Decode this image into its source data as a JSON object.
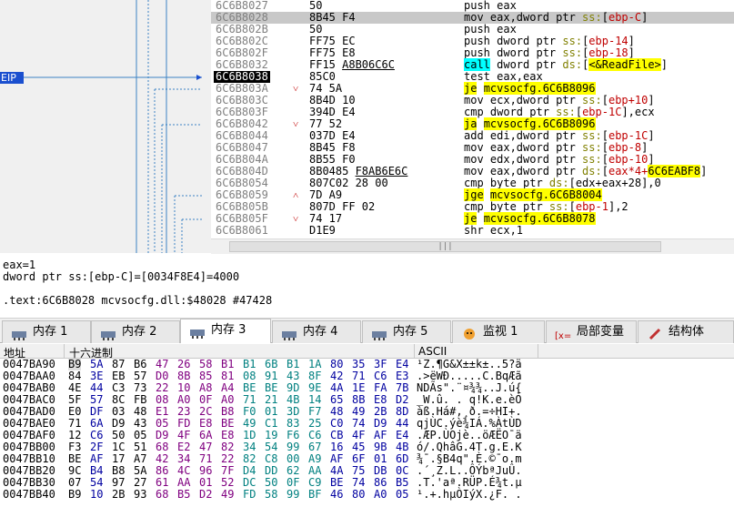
{
  "disasm": {
    "eip_label": "EIP",
    "rows": [
      {
        "addr": "6C6B8027",
        "bytes": "50",
        "jm": "",
        "ins": [
          [
            "push ",
            "t"
          ],
          [
            "eax",
            "t"
          ]
        ]
      },
      {
        "addr": "6C6B8028",
        "bytes": "8B45 F4",
        "jm": "",
        "sel": true,
        "ins": [
          [
            "mov eax,dword ptr ",
            "t"
          ],
          [
            "ss:",
            "s"
          ],
          [
            "[",
            "t"
          ],
          [
            "ebp-C",
            "o"
          ],
          [
            "]",
            "t"
          ]
        ]
      },
      {
        "addr": "6C6B802B",
        "bytes": "50",
        "jm": "",
        "ins": [
          [
            "push eax",
            "t"
          ]
        ]
      },
      {
        "addr": "6C6B802C",
        "bytes": "FF75 EC",
        "jm": "",
        "ins": [
          [
            "push dword ptr ",
            "t"
          ],
          [
            "ss:",
            "s"
          ],
          [
            "[",
            "t"
          ],
          [
            "ebp-14",
            "o"
          ],
          [
            "]",
            "t"
          ]
        ]
      },
      {
        "addr": "6C6B802F",
        "bytes": "FF75 E8",
        "jm": "",
        "ins": [
          [
            "push dword ptr ",
            "t"
          ],
          [
            "ss:",
            "s"
          ],
          [
            "[",
            "t"
          ],
          [
            "ebp-18",
            "o"
          ],
          [
            "]",
            "t"
          ]
        ]
      },
      {
        "addr": "6C6B8032",
        "bytes": "FF15 A8B06C6C",
        "jm": "",
        "ins": [
          [
            "call",
            "c"
          ],
          [
            " dword ptr ",
            "t"
          ],
          [
            "ds:",
            "s"
          ],
          [
            "[",
            "t"
          ],
          [
            "<&ReadFile>",
            "y"
          ],
          [
            "]",
            "t"
          ]
        ]
      },
      {
        "addr": "6C6B8038",
        "bytes": "85C0",
        "jm": "",
        "cur": true,
        "ins": [
          [
            "test eax,eax",
            "t"
          ]
        ]
      },
      {
        "addr": "6C6B803A",
        "bytes": "74 5A",
        "jm": "˅",
        "ins": [
          [
            "je",
            "y"
          ],
          [
            " ",
            "t"
          ],
          [
            "mcvsocfg.6C6B8096",
            "y"
          ]
        ]
      },
      {
        "addr": "6C6B803C",
        "bytes": "8B4D 10",
        "jm": "",
        "ins": [
          [
            "mov ecx,dword ptr ",
            "t"
          ],
          [
            "ss:",
            "s"
          ],
          [
            "[",
            "t"
          ],
          [
            "ebp+10",
            "o"
          ],
          [
            "]",
            "t"
          ]
        ]
      },
      {
        "addr": "6C6B803F",
        "bytes": "394D E4",
        "jm": "",
        "ins": [
          [
            "cmp dword ptr ",
            "t"
          ],
          [
            "ss:",
            "s"
          ],
          [
            "[",
            "t"
          ],
          [
            "ebp-1C",
            "o"
          ],
          [
            "],ecx",
            "t"
          ]
        ]
      },
      {
        "addr": "6C6B8042",
        "bytes": "77 52",
        "jm": "˅",
        "ins": [
          [
            "ja",
            "y"
          ],
          [
            " ",
            "t"
          ],
          [
            "mcvsocfg.6C6B8096",
            "y"
          ]
        ]
      },
      {
        "addr": "6C6B8044",
        "bytes": "037D E4",
        "jm": "",
        "ins": [
          [
            "add edi,dword ptr ",
            "t"
          ],
          [
            "ss:",
            "s"
          ],
          [
            "[",
            "t"
          ],
          [
            "ebp-1C",
            "o"
          ],
          [
            "]",
            "t"
          ]
        ]
      },
      {
        "addr": "6C6B8047",
        "bytes": "8B45 F8",
        "jm": "",
        "ins": [
          [
            "mov eax,dword ptr ",
            "t"
          ],
          [
            "ss:",
            "s"
          ],
          [
            "[",
            "t"
          ],
          [
            "ebp-8",
            "o"
          ],
          [
            "]",
            "t"
          ]
        ]
      },
      {
        "addr": "6C6B804A",
        "bytes": "8B55 F0",
        "jm": "",
        "ins": [
          [
            "mov edx,dword ptr ",
            "t"
          ],
          [
            "ss:",
            "s"
          ],
          [
            "[",
            "t"
          ],
          [
            "ebp-10",
            "o"
          ],
          [
            "]",
            "t"
          ]
        ]
      },
      {
        "addr": "6C6B804D",
        "bytes": "8B0485 F8AB6E6C",
        "jm": "",
        "ins": [
          [
            "mov eax,dword ptr ",
            "t"
          ],
          [
            "ds:",
            "s"
          ],
          [
            "[",
            "t"
          ],
          [
            "eax*4+",
            "o"
          ],
          [
            "6C6EABF8",
            "y"
          ],
          [
            "]",
            "t"
          ]
        ]
      },
      {
        "addr": "6C6B8054",
        "bytes": "807C02 28 00",
        "jm": "",
        "ins": [
          [
            "cmp byte ptr ",
            "t"
          ],
          [
            "ds:",
            "s"
          ],
          [
            "[edx+eax+28],0",
            "t"
          ]
        ]
      },
      {
        "addr": "6C6B8059",
        "bytes": "7D A9",
        "jm": "˄",
        "ins": [
          [
            "jge",
            "y"
          ],
          [
            " ",
            "t"
          ],
          [
            "mcvsocfg.6C6B8004",
            "y"
          ]
        ]
      },
      {
        "addr": "6C6B805B",
        "bytes": "807D FF 02",
        "jm": "",
        "ins": [
          [
            "cmp byte ptr ",
            "t"
          ],
          [
            "ss:",
            "s"
          ],
          [
            "[",
            "t"
          ],
          [
            "ebp-1",
            "o"
          ],
          [
            "],2",
            "t"
          ]
        ]
      },
      {
        "addr": "6C6B805F",
        "bytes": "74 17",
        "jm": "˅",
        "ins": [
          [
            "je",
            "y"
          ],
          [
            " ",
            "t"
          ],
          [
            "mcvsocfg.6C6B8078",
            "y"
          ]
        ]
      },
      {
        "addr": "6C6B8061",
        "bytes": "D1E9",
        "jm": "",
        "ins": [
          [
            "shr ecx,1",
            "t"
          ]
        ]
      }
    ]
  },
  "info": {
    "line1": "eax=1",
    "line2": "dword ptr ss:[ebp-C]=[0034F8E4]=4000",
    "line3": ".text:6C6B8028 mcvsocfg.dll:$48028 #47428"
  },
  "tabs": [
    {
      "label": "内存 1",
      "icon": "memory-icon"
    },
    {
      "label": "内存 2",
      "icon": "memory-icon"
    },
    {
      "label": "内存 3",
      "icon": "memory-icon",
      "active": true
    },
    {
      "label": "内存 4",
      "icon": "memory-icon"
    },
    {
      "label": "内存 5",
      "icon": "memory-icon"
    },
    {
      "label": "监视 1",
      "icon": "watch-icon"
    },
    {
      "label": "局部变量",
      "icon": "locals-icon"
    },
    {
      "label": "结构体",
      "icon": "struct-icon"
    }
  ],
  "hex": {
    "header_addr": "地址",
    "header_hex": "十六进制",
    "header_ascii": "ASCII",
    "rows": [
      {
        "addr": "0047BA90",
        "bytes": [
          "B9",
          "5A",
          "87",
          "B6",
          "47",
          "26",
          "58",
          "B1",
          "B1",
          "6B",
          "B1",
          "1A",
          "80",
          "35",
          "3F",
          "E4"
        ],
        "ascii": "¹Z.¶G&X±±k±..5?ä"
      },
      {
        "addr": "0047BAA0",
        "bytes": [
          "84",
          "3E",
          "EB",
          "57",
          "D0",
          "8B",
          "85",
          "81",
          "08",
          "91",
          "43",
          "8F",
          "42",
          "71",
          "C6",
          "E3"
        ],
        "ascii": ".>ëWÐ.....C.BqÆã"
      },
      {
        "addr": "0047BAB0",
        "bytes": [
          "4E",
          "44",
          "C3",
          "73",
          "22",
          "10",
          "A8",
          "A4",
          "BE",
          "BE",
          "9D",
          "9E",
          "4A",
          "1E",
          "FA",
          "7B"
        ],
        "ascii": "NDÃs\".¨¤¾¾..J.ú{"
      },
      {
        "addr": "0047BAC0",
        "bytes": [
          "5F",
          "57",
          "8C",
          "FB",
          "08",
          "A0",
          "0F",
          "A0",
          "71",
          "21",
          "4B",
          "14",
          "65",
          "8B",
          "E8",
          "D2"
        ],
        "ascii": "_W.û. . q!K.e.èÒ"
      },
      {
        "addr": "0047BAD0",
        "bytes": [
          "E0",
          "DF",
          "03",
          "48",
          "E1",
          "23",
          "2C",
          "B8",
          "F0",
          "01",
          "3D",
          "F7",
          "48",
          "49",
          "2B",
          "8D"
        ],
        "ascii": "àß.Há#,¸ð.=÷HI+."
      },
      {
        "addr": "0047BAE0",
        "bytes": [
          "71",
          "6A",
          "D9",
          "43",
          "05",
          "FD",
          "E8",
          "BE",
          "49",
          "C1",
          "83",
          "25",
          "C0",
          "74",
          "D9",
          "44"
        ],
        "ascii": "qjÙC.ýè¾IÁ.%ÀtÙD"
      },
      {
        "addr": "0047BAF0",
        "bytes": [
          "12",
          "C6",
          "50",
          "05",
          "D9",
          "4F",
          "6A",
          "E8",
          "1D",
          "19",
          "F6",
          "C6",
          "CB",
          "4F",
          "AF",
          "E4"
        ],
        "ascii": ".ÆP.ÙOjè..öÆËO¯ä"
      },
      {
        "addr": "0047BB00",
        "bytes": [
          "F3",
          "2F",
          "1C",
          "51",
          "68",
          "E2",
          "47",
          "82",
          "34",
          "54",
          "99",
          "67",
          "16",
          "45",
          "9B",
          "4B"
        ],
        "ascii": "ó/.QhâG.4T.g.E.K"
      },
      {
        "addr": "0047BB10",
        "bytes": [
          "BE",
          "AF",
          "17",
          "A7",
          "42",
          "34",
          "71",
          "22",
          "82",
          "C8",
          "00",
          "A9",
          "AF",
          "6F",
          "01",
          "6D"
        ],
        "ascii": "¾¯.§B4q\".È.©¯o.m"
      },
      {
        "addr": "0047BB20",
        "bytes": [
          "9C",
          "B4",
          "B8",
          "5A",
          "86",
          "4C",
          "96",
          "7F",
          "D4",
          "DD",
          "62",
          "AA",
          "4A",
          "75",
          "DB",
          "0C"
        ],
        "ascii": ".´¸Z.L..ÔÝbªJuÛ."
      },
      {
        "addr": "0047BB30",
        "bytes": [
          "07",
          "54",
          "97",
          "27",
          "61",
          "AA",
          "01",
          "52",
          "DC",
          "50",
          "0F",
          "C9",
          "BE",
          "74",
          "86",
          "B5"
        ],
        "ascii": ".T.'aª.RÜP.É¾t.µ"
      },
      {
        "addr": "0047BB40",
        "bytes": [
          "B9",
          "10",
          "2B",
          "93",
          "68",
          "B5",
          "D2",
          "49",
          "FD",
          "58",
          "99",
          "BF",
          "46",
          "80",
          "A0",
          "05"
        ],
        "ascii": "¹.+.hµÒIýX.¿F. ."
      }
    ]
  }
}
